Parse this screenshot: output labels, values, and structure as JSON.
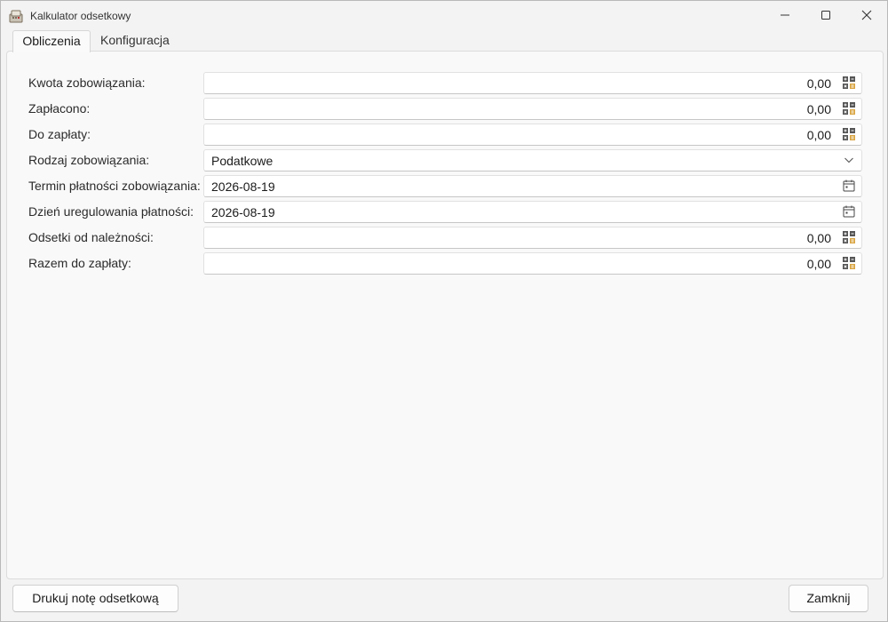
{
  "window": {
    "title": "Kalkulator odsetkowy"
  },
  "tabs": [
    {
      "label": "Obliczenia",
      "active": true
    },
    {
      "label": "Konfiguracja",
      "active": false
    }
  ],
  "form": {
    "kwota": {
      "label": "Kwota zobowiązania:",
      "value": "0,00",
      "icon": "calculator-icon"
    },
    "zaplacono": {
      "label": "Zapłacono:",
      "value": "0,00",
      "icon": "calculator-icon"
    },
    "do_zaplaty": {
      "label": "Do zapłaty:",
      "value": "0,00",
      "icon": "calculator-icon"
    },
    "rodzaj": {
      "label": "Rodzaj zobowiązania:",
      "value": "Podatkowe",
      "icon": "chevron-down-icon"
    },
    "termin": {
      "label": "Termin płatności zobowiązania:",
      "value": "2026-08-19",
      "icon": "calendar-icon"
    },
    "dzien": {
      "label": "Dzień uregulowania płatności:",
      "value": "2026-08-19",
      "icon": "calendar-icon"
    },
    "odsetki": {
      "label": "Odsetki od należności:",
      "value": "0,00",
      "icon": "calculator-icon"
    },
    "razem": {
      "label": "Razem do zapłaty:",
      "value": "0,00",
      "icon": "calculator-icon"
    }
  },
  "footer": {
    "print_label": "Drukuj notę odsetkową",
    "close_label": "Zamknij"
  },
  "colors": {
    "calc_dark": "#555555",
    "calc_accent": "#d9a441"
  }
}
